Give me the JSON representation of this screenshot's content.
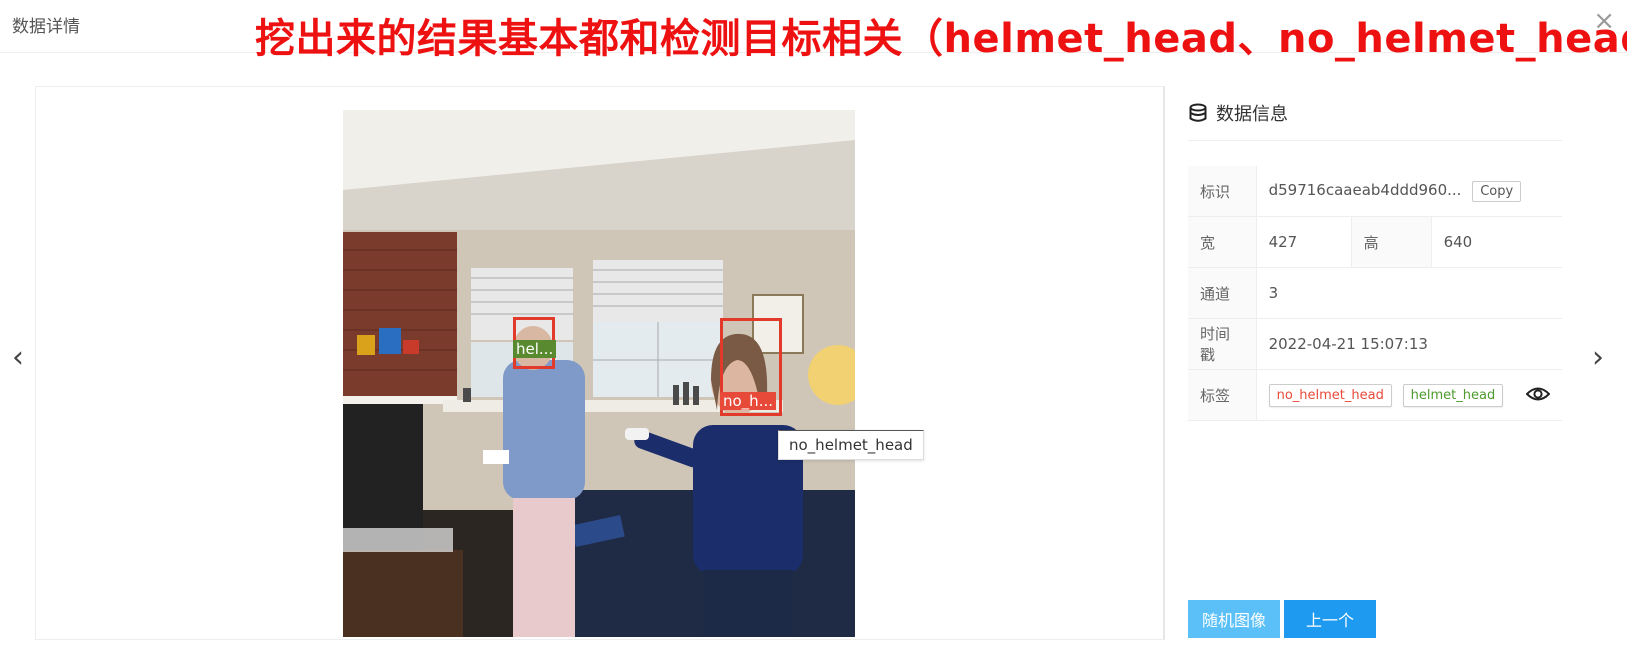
{
  "dialog": {
    "title": "数据详情",
    "close": "×"
  },
  "banner": "挖出来的结果基本都和检测目标相关（helmet_head、no_helmet_head）",
  "nav": {
    "prev": "‹",
    "next": "›"
  },
  "image": {
    "boxes": [
      {
        "class": "helmet_head",
        "label": "hel...",
        "color": "#5a8a2f"
      },
      {
        "class": "no_helmet_head",
        "label": "no_h...",
        "color": "#e84a3a"
      }
    ],
    "tooltip": "no_helmet_head"
  },
  "info": {
    "title": "数据信息",
    "icon": "database-icon",
    "rows": {
      "id": {
        "label": "标识",
        "value": "d59716caaeab4ddd960...",
        "copy": "Copy"
      },
      "width": {
        "label": "宽",
        "value": "427"
      },
      "height": {
        "label": "高",
        "value": "640"
      },
      "channels": {
        "label": "通道",
        "value": "3"
      },
      "timestamp": {
        "label": "时间戳",
        "value": "2022-04-21 15:07:13"
      },
      "tags": {
        "label": "标签",
        "items": [
          {
            "name": "no_helmet_head",
            "color": "#e84a3a"
          },
          {
            "name": "helmet_head",
            "color": "#4e9a2f"
          }
        ],
        "toggle_icon": "eye-icon"
      }
    }
  },
  "buttons": {
    "random": "随机图像",
    "prev": "上一个"
  },
  "colors": {
    "banner": "#ee1111",
    "button_light": "#5bc0f8",
    "button_main": "#1e9bf0"
  }
}
